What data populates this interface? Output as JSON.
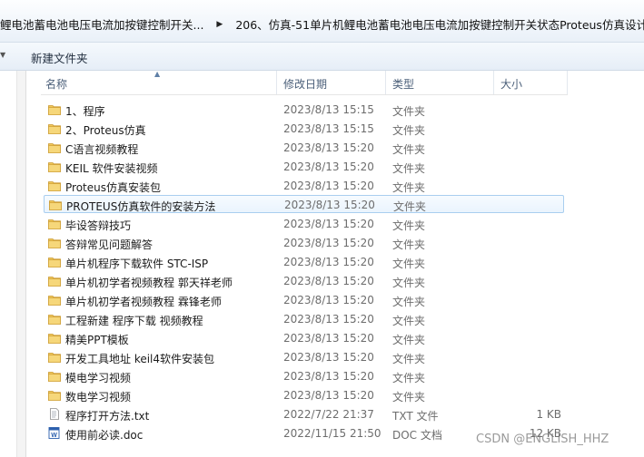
{
  "breadcrumb": {
    "items": [
      "鲤电池蓄电池电压电流加按键控制开关...",
      "206、仿真-51单片机鲤电池蓄电池电压电流加按键控制开关状态Proteus仿真设计"
    ]
  },
  "toolbar": {
    "new_folder_label": "新建文件夹"
  },
  "columns": {
    "name": "名称",
    "date": "修改日期",
    "type": "类型",
    "size": "大小"
  },
  "files": [
    {
      "name": "1、程序",
      "date": "2023/8/13 15:15",
      "type": "文件夹",
      "size": "",
      "icon": "folder-icon"
    },
    {
      "name": "2、Proteus仿真",
      "date": "2023/8/13 15:15",
      "type": "文件夹",
      "size": "",
      "icon": "folder-icon"
    },
    {
      "name": "C语言视频教程",
      "date": "2023/8/13 15:20",
      "type": "文件夹",
      "size": "",
      "icon": "folder-icon"
    },
    {
      "name": "KEIL 软件安装视频",
      "date": "2023/8/13 15:20",
      "type": "文件夹",
      "size": "",
      "icon": "folder-icon"
    },
    {
      "name": "Proteus仿真安装包",
      "date": "2023/8/13 15:20",
      "type": "文件夹",
      "size": "",
      "icon": "folder-icon"
    },
    {
      "name": "PROTEUS仿真软件的安装方法",
      "date": "2023/8/13 15:20",
      "type": "文件夹",
      "size": "",
      "icon": "folder-icon"
    },
    {
      "name": "毕设答辩技巧",
      "date": "2023/8/13 15:20",
      "type": "文件夹",
      "size": "",
      "icon": "folder-icon"
    },
    {
      "name": "答辩常见问题解答",
      "date": "2023/8/13 15:20",
      "type": "文件夹",
      "size": "",
      "icon": "folder-icon"
    },
    {
      "name": "单片机程序下载软件 STC-ISP",
      "date": "2023/8/13 15:20",
      "type": "文件夹",
      "size": "",
      "icon": "folder-icon"
    },
    {
      "name": "单片机初学者视频教程 郭天祥老师",
      "date": "2023/8/13 15:20",
      "type": "文件夹",
      "size": "",
      "icon": "folder-icon"
    },
    {
      "name": "单片机初学者视频教程 霖锋老师",
      "date": "2023/8/13 15:20",
      "type": "文件夹",
      "size": "",
      "icon": "folder-icon"
    },
    {
      "name": "工程新建  程序下载 视频教程",
      "date": "2023/8/13 15:20",
      "type": "文件夹",
      "size": "",
      "icon": "folder-icon"
    },
    {
      "name": "精美PPT模板",
      "date": "2023/8/13 15:20",
      "type": "文件夹",
      "size": "",
      "icon": "folder-icon"
    },
    {
      "name": "开发工具地址 keil4软件安装包",
      "date": "2023/8/13 15:20",
      "type": "文件夹",
      "size": "",
      "icon": "folder-icon"
    },
    {
      "name": "模电学习视频",
      "date": "2023/8/13 15:20",
      "type": "文件夹",
      "size": "",
      "icon": "folder-icon"
    },
    {
      "name": "数电学习视频",
      "date": "2023/8/13 15:20",
      "type": "文件夹",
      "size": "",
      "icon": "folder-icon"
    },
    {
      "name": "程序打开方法.txt",
      "date": "2022/7/22 21:37",
      "type": "TXT 文件",
      "size": "1 KB",
      "icon": "text-file-icon"
    },
    {
      "name": "使用前必读.doc",
      "date": "2022/11/15 21:50",
      "type": "DOC 文档",
      "size": "12 KB",
      "icon": "word-doc-icon"
    }
  ],
  "selected_index": 5,
  "watermark": "CSDN @ENGLISH_HHZ",
  "colors": {
    "folder": "#e8b84a",
    "selection_border": "#a9ceef",
    "header_text": "#4c607a"
  }
}
